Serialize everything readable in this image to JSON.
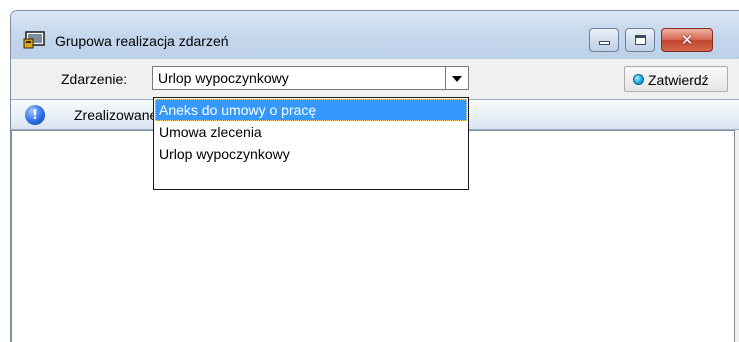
{
  "window": {
    "title": "Grupowa realizacja zdarzeń"
  },
  "toolbar": {
    "event_label": "Zdarzenie:",
    "event_value": "Urlop wypoczynkowy",
    "confirm_label": "Zatwierdź"
  },
  "table": {
    "column_header": "Zrealizowane"
  },
  "dropdown": {
    "options": [
      "Aneks do umowy o pracę",
      "Umowa zlecenia",
      "Urlop wypoczynkowy"
    ],
    "highlighted_index": 0
  },
  "icons": {
    "app": "window-app-icon",
    "confirm": "blue-dot-icon",
    "info": "info-icon"
  },
  "colors": {
    "selection": "#3399ff",
    "close_button": "#c2452c"
  }
}
